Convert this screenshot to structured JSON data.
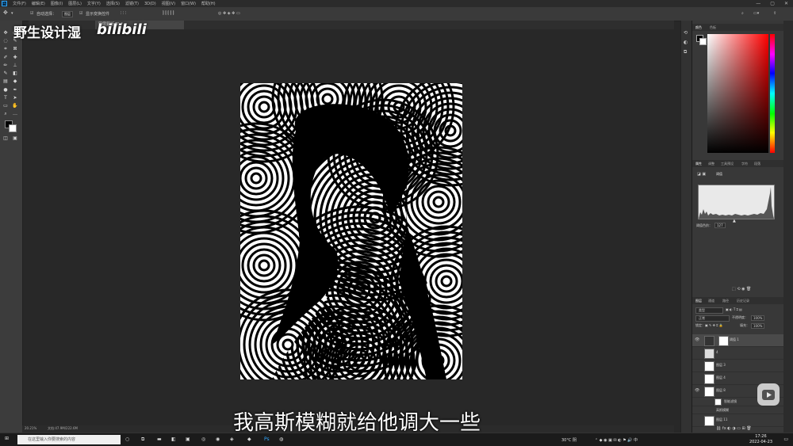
{
  "menubar": {
    "logo": "Ps",
    "items": [
      "文件(F)",
      "编辑(E)",
      "图像(I)",
      "图层(L)",
      "文字(Y)",
      "选择(S)",
      "滤镜(T)",
      "3D(D)",
      "视图(V)",
      "窗口(W)",
      "帮助(H)"
    ],
    "minimize": "—",
    "maximize": "▢",
    "close": "✕"
  },
  "options": {
    "auto_select_label": "自动选择：",
    "auto_select_value": "图层",
    "transform_label": "显示变换控件"
  },
  "document": {
    "tab_label": "图层蒙版/8) *"
  },
  "watermark": {
    "name": "野生设计湿",
    "site": "bilibili"
  },
  "subtitle": {
    "text": "我高斯模糊就给他调大一些"
  },
  "status": {
    "zoom": "20.21%",
    "doc": "文档:47.9M/222.6M"
  },
  "panels": {
    "color_tabs": [
      "颜色",
      "色板"
    ],
    "props_tabs": [
      "属性",
      "调整",
      "工具预设",
      "字符",
      "段落"
    ],
    "props_title": "阈值",
    "threshold_label": "阈值色阶：",
    "threshold_value": "127",
    "layers_tabs": [
      "图层",
      "通道",
      "路径",
      "历史记录"
    ],
    "kind_label": "类型",
    "blend_mode": "正常",
    "opacity_label": "不透明度：",
    "opacity_value": "100%",
    "lock_label": "锁定：",
    "fill_label": "填充：",
    "fill_value": "100%",
    "layers": [
      {
        "name": "阈值 1"
      },
      {
        "name": "4"
      },
      {
        "name": "图层 3"
      },
      {
        "name": "图层 4"
      },
      {
        "name": "图层 8"
      },
      {
        "name": "智能滤镜"
      },
      {
        "name": "高斯模糊"
      },
      {
        "name": "图层 11"
      }
    ]
  },
  "taskbar": {
    "search_placeholder": "在这里输入你要搜索的内容",
    "weather": "30°C 阴",
    "time": "17:26",
    "date": "2022-04-23"
  }
}
